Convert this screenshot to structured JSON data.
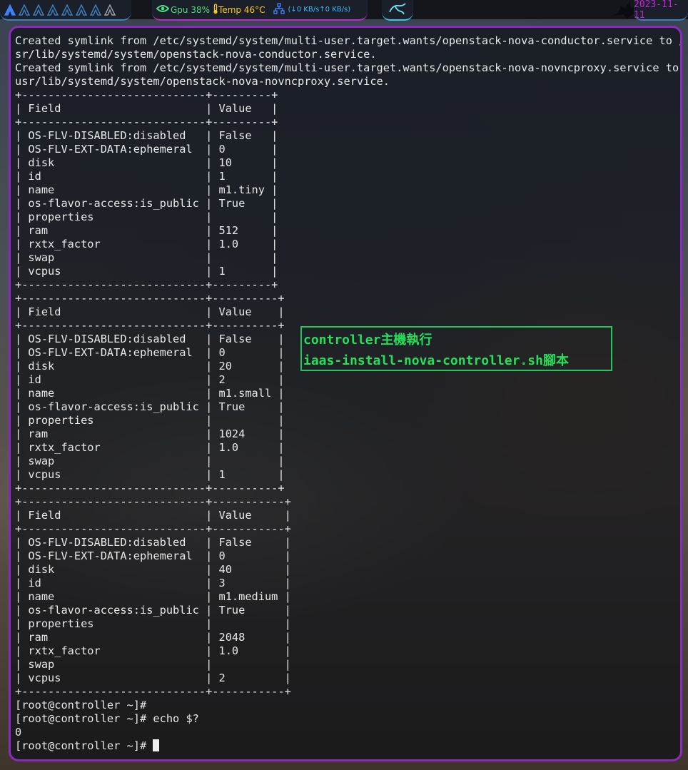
{
  "topbar": {
    "workspaces": [
      "A",
      "A",
      "A",
      "A",
      "A",
      "A",
      "A",
      "A"
    ],
    "gpu_label": "Gpu 38%",
    "temp_label": "Temp 46°C",
    "net_label": "(↓0 KB/s↑0 KB/s)",
    "date": "2023-11-11",
    "colors": {
      "accent_purple": "#c026d3",
      "accent_blue": "#3b82c4",
      "gpu_green": "#4ade80",
      "temp_yellow": "#facc15",
      "net_cyan": "#38bdf8"
    }
  },
  "terminal": {
    "lines": [
      "Created symlink from /etc/systemd/system/multi-user.target.wants/openstack-nova-conductor.service to /u",
      "sr/lib/systemd/system/openstack-nova-conductor.service.",
      "Created symlink from /etc/systemd/system/multi-user.target.wants/openstack-nova-novncproxy.service to /",
      "usr/lib/systemd/system/openstack-nova-novncproxy.service.",
      "+----------------------------+---------+",
      "| Field                      | Value   |",
      "+----------------------------+---------+",
      "| OS-FLV-DISABLED:disabled   | False   |",
      "| OS-FLV-EXT-DATA:ephemeral  | 0       |",
      "| disk                       | 10      |",
      "| id                         | 1       |",
      "| name                       | m1.tiny |",
      "| os-flavor-access:is_public | True    |",
      "| properties                 |         |",
      "| ram                        | 512     |",
      "| rxtx_factor                | 1.0     |",
      "| swap                       |         |",
      "| vcpus                      | 1       |",
      "+----------------------------+---------+",
      "+----------------------------+----------+",
      "| Field                      | Value    |",
      "+----------------------------+----------+",
      "| OS-FLV-DISABLED:disabled   | False    |",
      "| OS-FLV-EXT-DATA:ephemeral  | 0        |",
      "| disk                       | 20       |",
      "| id                         | 2        |",
      "| name                       | m1.small |",
      "| os-flavor-access:is_public | True     |",
      "| properties                 |          |",
      "| ram                        | 1024     |",
      "| rxtx_factor                | 1.0      |",
      "| swap                       |          |",
      "| vcpus                      | 1        |",
      "+----------------------------+----------+",
      "+----------------------------+-----------+",
      "| Field                      | Value     |",
      "+----------------------------+-----------+",
      "| OS-FLV-DISABLED:disabled   | False     |",
      "| OS-FLV-EXT-DATA:ephemeral  | 0         |",
      "| disk                       | 40        |",
      "| id                         | 3         |",
      "| name                       | m1.medium |",
      "| os-flavor-access:is_public | True      |",
      "| properties                 |           |",
      "| ram                        | 2048      |",
      "| rxtx_factor                | 1.0       |",
      "| swap                       |           |",
      "| vcpus                      | 2         |",
      "+----------------------------+-----------+",
      "[root@controller ~]#",
      "[root@controller ~]# echo $?",
      "0"
    ],
    "prompt": "[root@controller ~]# ",
    "border_color": "#8b2bbd"
  },
  "annotation": {
    "line1": "controller主機執行",
    "line2": "iaas-install-nova-controller.sh腳本",
    "color": "#22c55e"
  }
}
